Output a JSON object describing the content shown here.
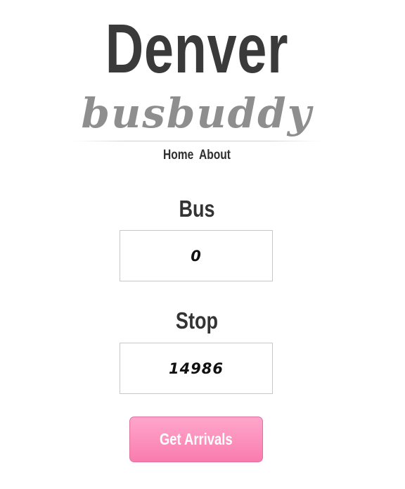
{
  "header": {
    "title": "Denver",
    "subtitle": "busbuddy"
  },
  "nav": {
    "items": [
      {
        "label": "Home"
      },
      {
        "label": "About"
      }
    ]
  },
  "form": {
    "bus": {
      "label": "Bus",
      "value": "0"
    },
    "stop": {
      "label": "Stop",
      "value": "14986"
    },
    "submit_label": "Get Arrivals"
  },
  "colors": {
    "title": "#3a3a3a",
    "subtitle": "#8e8e8e",
    "button_top": "#ffa6cb",
    "button_bottom": "#f97cae",
    "button_text": "#ffffff"
  }
}
